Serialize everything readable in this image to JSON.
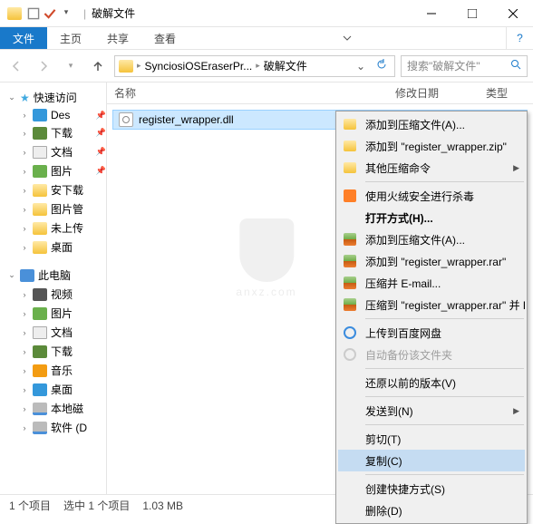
{
  "window": {
    "title": "破解文件"
  },
  "ribbon": {
    "file": "文件",
    "home": "主页",
    "share": "共享",
    "view": "查看"
  },
  "address": {
    "crumb1": "SynciosiOSEraserPr...",
    "crumb2": "破解文件"
  },
  "search": {
    "placeholder": "搜索\"破解文件\""
  },
  "columns": {
    "name": "名称",
    "date": "修改日期",
    "type": "类型"
  },
  "file": {
    "name": "register_wrapper.dll"
  },
  "sidebar": {
    "quick": "快速访问",
    "items_quick": [
      {
        "label": "Des",
        "icon": "desktop",
        "pin": true
      },
      {
        "label": "下载",
        "icon": "dl",
        "pin": true
      },
      {
        "label": "文档",
        "icon": "doc",
        "pin": true
      },
      {
        "label": "图片",
        "icon": "pic",
        "pin": true
      },
      {
        "label": "安下载",
        "icon": "folder"
      },
      {
        "label": "图片管",
        "icon": "folder"
      },
      {
        "label": "未上传",
        "icon": "folder"
      },
      {
        "label": "桌面",
        "icon": "folder"
      }
    ],
    "pc": "此电脑",
    "items_pc": [
      {
        "label": "视频",
        "icon": "video"
      },
      {
        "label": "图片",
        "icon": "pic"
      },
      {
        "label": "文档",
        "icon": "doc"
      },
      {
        "label": "下载",
        "icon": "dl"
      },
      {
        "label": "音乐",
        "icon": "music"
      },
      {
        "label": "桌面",
        "icon": "desktop"
      },
      {
        "label": "本地磁",
        "icon": "disk"
      },
      {
        "label": "软件 (D",
        "icon": "disk"
      }
    ]
  },
  "context": {
    "add_zip_a": "添加到压缩文件(A)...",
    "add_zip_name": "添加到 \"register_wrapper.zip\"",
    "other_zip": "其他压缩命令",
    "huorong": "使用火绒安全进行杀毒",
    "open_with": "打开方式(H)...",
    "rar_add_a": "添加到压缩文件(A)...",
    "rar_add_name": "添加到 \"register_wrapper.rar\"",
    "rar_email": "压缩并 E-mail...",
    "rar_email_name": "压缩到 \"register_wrapper.rar\" 并 E",
    "baidu_upload": "上传到百度网盘",
    "baidu_backup": "自动备份该文件夹",
    "restore": "还原以前的版本(V)",
    "send_to": "发送到(N)",
    "cut": "剪切(T)",
    "copy": "复制(C)",
    "shortcut": "创建快捷方式(S)",
    "delete": "删除(D)"
  },
  "status": {
    "items": "1 个项目",
    "selected": "选中 1 个项目",
    "size": "1.03 MB"
  },
  "watermark": "anxz.com"
}
